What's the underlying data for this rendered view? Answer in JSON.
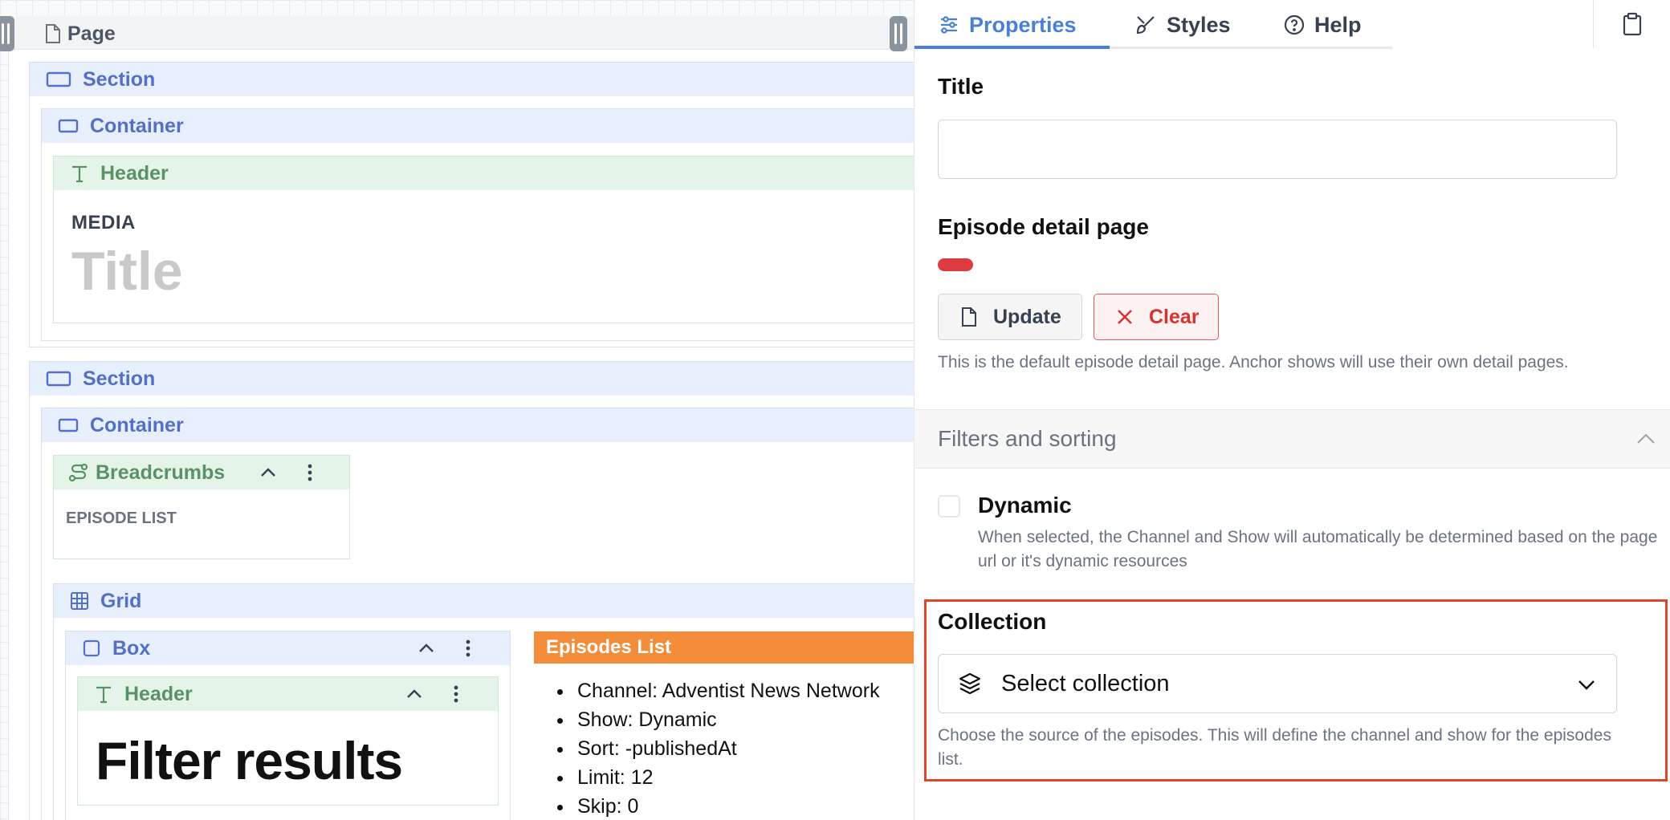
{
  "canvas": {
    "page_label": "Page",
    "section1": {
      "label": "Section",
      "container_label": "Container",
      "header_label": "Header",
      "media": "MEDIA",
      "title": "Title"
    },
    "section2": {
      "label": "Section",
      "container_label": "Container",
      "breadcrumbs_label": "Breadcrumbs",
      "episode_list": "EPISODE LIST",
      "grid_label": "Grid",
      "box_label": "Box",
      "header_label": "Header",
      "filter_results": "Filter results",
      "episodes_list": {
        "label": "Episodes List",
        "items": [
          "Channel: Adventist News Network",
          "Show: Dynamic",
          "Sort: -publishedAt",
          "Limit: 12",
          "Skip: 0"
        ]
      }
    }
  },
  "panel": {
    "tabs": [
      {
        "label": "Properties",
        "icon": "sliders-icon",
        "active": true
      },
      {
        "label": "Styles",
        "icon": "brush-icon",
        "active": false
      },
      {
        "label": "Help",
        "icon": "help-circle-icon",
        "active": false
      }
    ],
    "title_field": {
      "label": "Title",
      "value": "",
      "placeholder": ""
    },
    "episode_detail": {
      "label": "Episode detail page",
      "status_color": "#dc3b40",
      "update_label": "Update",
      "clear_label": "Clear",
      "help": "This is the default episode detail page. Anchor shows will use their own detail pages."
    },
    "filters_section": {
      "label": "Filters and sorting",
      "expanded": true
    },
    "dynamic": {
      "label": "Dynamic",
      "checked": false,
      "help": "When selected, the Channel and Show will automatically be determined based on the page url or it's dynamic resources"
    },
    "collection": {
      "label": "Collection",
      "select_value": "Select collection",
      "help": "Choose the source of the episodes. This will define the channel and show for the episodes list."
    }
  },
  "colors": {
    "accent": "#4a7fd6",
    "section_blue": "#5470c6",
    "block_green": "#5a9168",
    "episodes_orange": "#f48d3a",
    "danger": "#d93030",
    "highlight": "#e0452f"
  }
}
